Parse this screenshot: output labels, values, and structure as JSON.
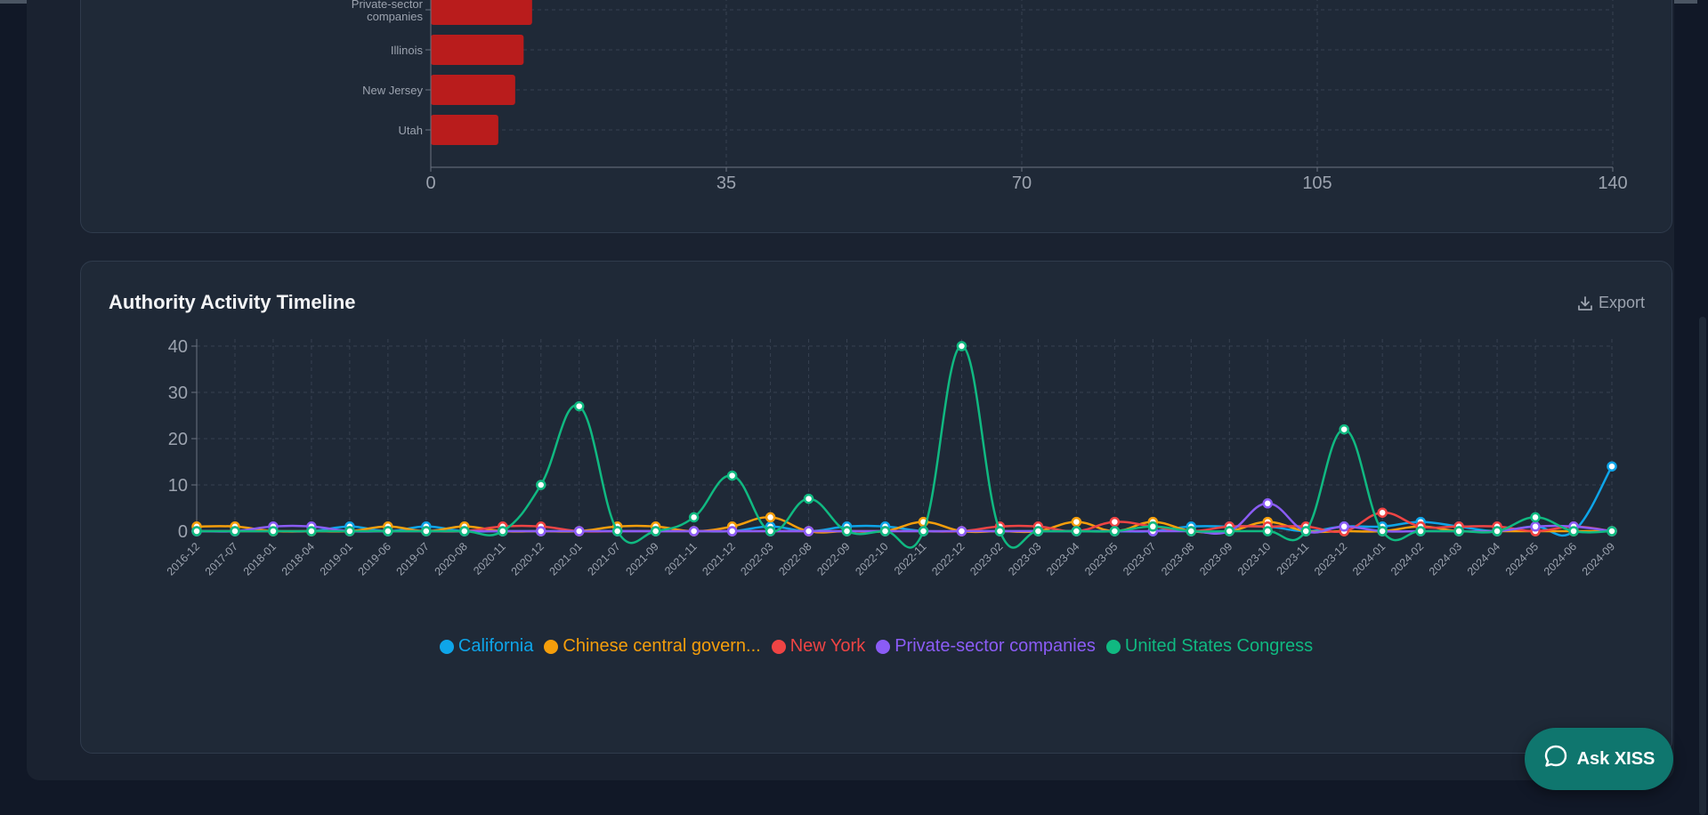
{
  "colors": {
    "bar": "#b91c1c",
    "grid": "#374151",
    "axis": "#6b7280",
    "tick_label": "#9ca3af",
    "background": "#1f2937"
  },
  "top_chart": {
    "type": "bar",
    "orientation": "horizontal",
    "categories": [
      "Private-sector companies",
      "Illinois",
      "New Jersey",
      "Utah"
    ],
    "category_lines": [
      [
        "Private-sector",
        "companies"
      ],
      [
        "Illinois"
      ],
      [
        "New Jersey"
      ],
      [
        "Utah"
      ]
    ],
    "values": [
      12,
      11,
      10,
      8
    ],
    "xlim": [
      0,
      140
    ],
    "xticks": [
      "0",
      "35",
      "70",
      "105",
      "140"
    ]
  },
  "timeline_card": {
    "title": "Authority Activity Timeline",
    "export_label": "Export",
    "export_icon": "download-icon"
  },
  "chart_data": [
    {
      "type": "bar",
      "orientation": "horizontal",
      "categories": [
        "Private-sector companies",
        "Illinois",
        "New Jersey",
        "Utah"
      ],
      "values": [
        12,
        11,
        10,
        8
      ],
      "xlim": [
        0,
        140
      ],
      "grid": true
    },
    {
      "type": "line",
      "title": "Authority Activity Timeline",
      "x": [
        "2016-12",
        "2017-07",
        "2018-01",
        "2018-04",
        "2019-01",
        "2019-06",
        "2019-07",
        "2020-08",
        "2020-11",
        "2020-12",
        "2021-01",
        "2021-07",
        "2021-09",
        "2021-11",
        "2021-12",
        "2022-03",
        "2022-08",
        "2022-09",
        "2022-10",
        "2022-11",
        "2022-12",
        "2023-02",
        "2023-03",
        "2023-04",
        "2023-05",
        "2023-07",
        "2023-08",
        "2023-09",
        "2023-10",
        "2023-11",
        "2023-12",
        "2024-01",
        "2024-02",
        "2024-03",
        "2024-04",
        "2024-05",
        "2024-06",
        "2024-09"
      ],
      "yticks": [
        "0",
        "10",
        "20",
        "30",
        "40"
      ],
      "ylim": [
        0,
        40
      ],
      "grid": true,
      "legend_position": "bottom",
      "series": [
        {
          "name": "California",
          "color": "#0ea5e9",
          "values": [
            0,
            0,
            0,
            0,
            1,
            0,
            1,
            0,
            0,
            0,
            0,
            0,
            0,
            0,
            0,
            1,
            0,
            1,
            1,
            0,
            0,
            0,
            0,
            0,
            0,
            0,
            1,
            1,
            1,
            0,
            1,
            1,
            2,
            1,
            0,
            1,
            0,
            14
          ]
        },
        {
          "name": "Chinese central govern...",
          "color": "#f59e0b",
          "values": [
            1,
            1,
            0,
            0,
            0,
            1,
            0,
            1,
            0,
            0,
            0,
            1,
            1,
            0,
            1,
            3,
            0,
            0,
            0,
            2,
            0,
            0,
            0,
            2,
            0,
            2,
            0,
            0,
            2,
            0,
            0,
            0,
            1,
            0,
            0,
            0,
            0,
            0
          ]
        },
        {
          "name": "New York",
          "color": "#ef4444",
          "values": [
            0,
            0,
            0,
            0,
            0,
            0,
            0,
            0,
            1,
            1,
            0,
            0,
            0,
            0,
            0,
            0,
            0,
            0,
            0,
            0,
            0,
            1,
            1,
            0,
            2,
            1,
            0,
            1,
            1,
            1,
            0,
            4,
            1,
            1,
            1,
            0,
            1,
            0
          ]
        },
        {
          "name": "Private-sector companies",
          "color": "#8b5cf6",
          "values": [
            0,
            0,
            1,
            1,
            0,
            0,
            0,
            0,
            0,
            0,
            0,
            0,
            0,
            0,
            0,
            0,
            0,
            0,
            0,
            0,
            0,
            0,
            0,
            0,
            0,
            0,
            0,
            0,
            6,
            0,
            1,
            0,
            0,
            0,
            0,
            1,
            1,
            0
          ]
        },
        {
          "name": "United States Congress",
          "color": "#10b981",
          "values": [
            0,
            0,
            0,
            0,
            0,
            0,
            0,
            0,
            0,
            10,
            27,
            0,
            0,
            3,
            12,
            0,
            7,
            0,
            0,
            0,
            40,
            0,
            0,
            0,
            0,
            1,
            0,
            0,
            0,
            0,
            22,
            0,
            0,
            0,
            0,
            3,
            0,
            0
          ]
        }
      ]
    }
  ],
  "assistant_button": {
    "label": "Ask XISS",
    "icon": "chat-bubble-icon"
  }
}
